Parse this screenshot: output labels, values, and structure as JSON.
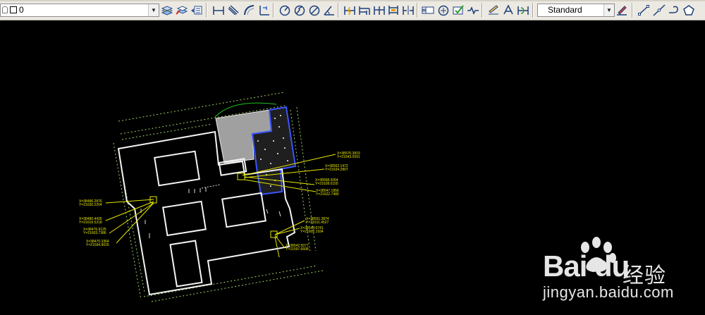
{
  "toolbar": {
    "layer_value": "0",
    "text_style_value": "Standard",
    "icons": [
      "layer-properties-icon",
      "make-current-layer-icon",
      "layer-previous-icon",
      "linear-dimension-icon",
      "aligned-dimension-icon",
      "arc-length-dimension-icon",
      "ordinate-dimension-icon",
      "radius-dimension-icon",
      "jogged-dimension-icon",
      "diameter-dimension-icon",
      "angular-dimension-icon",
      "quick-dimension-icon",
      "baseline-dimension-icon",
      "continue-dimension-icon",
      "dimension-space-icon",
      "dimension-break-icon",
      "tolerance-icon",
      "center-mark-icon",
      "inspection-icon",
      "jogged-linear-icon",
      "dimension-edit-icon",
      "dimension-text-edit-icon",
      "dimension-update-icon",
      "dimension-style-icon",
      "line-icon",
      "construction-line-icon",
      "polyline-icon",
      "polygon-icon"
    ]
  },
  "watermark": {
    "brand_text": "Bai du",
    "product_text": "经验",
    "url": "jingyan.baidu.com"
  },
  "annotations": {
    "right_labels": [
      "X=38576.3819",
      "Y=21643.0591",
      "X=38562.1472",
      "Y=21634.2807",
      "X=38568.3064",
      "Y=21628.0155",
      "X=38547.1856",
      "Y=21622.7480",
      "X=38551.3874",
      "Y=21611.4527",
      "X=38544.6741",
      "Y=21602.1934",
      "X=38542.5077",
      "Y=21597.6608"
    ],
    "left_labels": [
      "X=38486.2876",
      "Y=21630.2204",
      "X=38480.4426",
      "Y=21616.5218",
      "X=38476.9125",
      "Y=21603.7386",
      "X=38470.3364",
      "Y=21594.9025"
    ]
  }
}
